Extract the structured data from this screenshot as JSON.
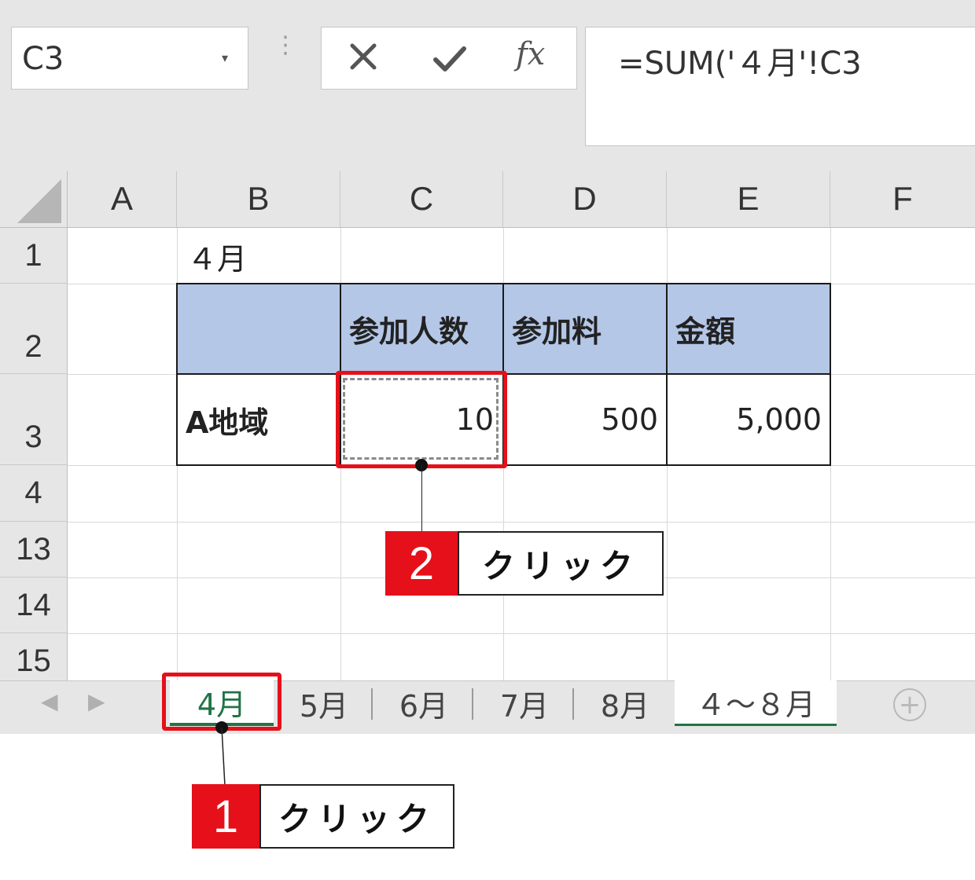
{
  "formula_bar": {
    "name_box": "C3",
    "name_caret": "▾",
    "dots": "⋮",
    "fx_label": "fx",
    "formula": "=SUM('４月'!C3"
  },
  "columns": [
    "A",
    "B",
    "C",
    "D",
    "E",
    "F"
  ],
  "rows": [
    "1",
    "2",
    "3",
    "4",
    "13",
    "14",
    "15"
  ],
  "cells": {
    "B1": "４月",
    "C2": "参加人数",
    "D2": "参加料",
    "E2": "金額",
    "B3": "A地域",
    "C3": "10",
    "D3": "500",
    "E3": "5,000"
  },
  "sheet_tabs": [
    "4月",
    "5月",
    "6月",
    "7月",
    "8月",
    "４～８月"
  ],
  "nav": {
    "prev": "◀",
    "next": "▶",
    "add": "+"
  },
  "annotations": {
    "step1_number": "1",
    "step1_label": "クリック",
    "step2_number": "2",
    "step2_label": "クリック"
  },
  "colors": {
    "header_fill": "#b4c7e7",
    "highlight": "#e5101a",
    "excel_green": "#217346"
  }
}
